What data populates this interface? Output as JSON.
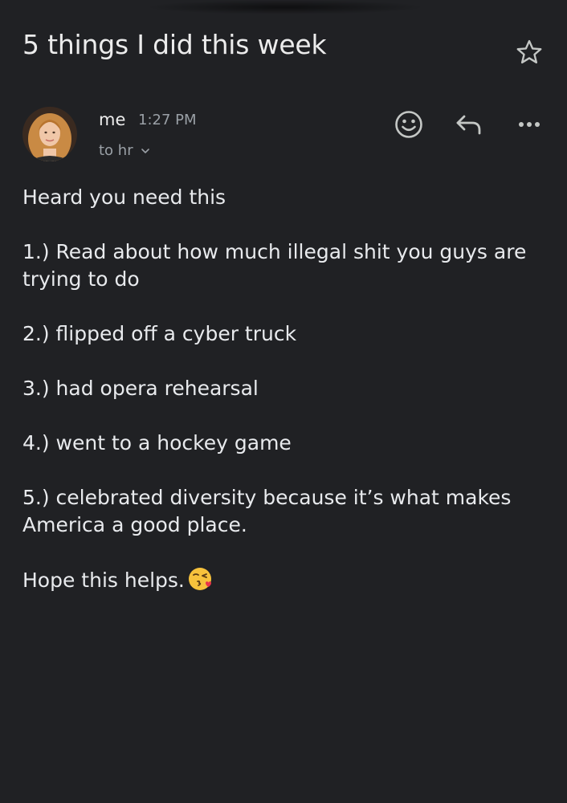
{
  "email": {
    "subject": "5 things I did this week",
    "sender": {
      "name": "me",
      "time": "1:27 PM",
      "recipient": "to hr"
    },
    "body": {
      "greeting": "Heard you need this",
      "items": [
        "1.) Read about how much illegal shit you guys are trying to do",
        "2.) flipped off a cyber truck",
        "3.) had opera rehearsal",
        "4.) went to a hockey game",
        "5.) celebrated diversity because it’s what makes America a good place."
      ],
      "closing": "Hope this helps."
    }
  },
  "icons": {
    "star": "star-outline-icon",
    "emoji_reaction": "smiley-face-icon",
    "reply": "reply-arrow-icon",
    "more": "more-dots-icon",
    "recipient_toggle": "chevron-down-icon",
    "closing_emoji": "face-blowing-kiss-emoji"
  },
  "colors": {
    "background": "#202124",
    "primary_text": "#e8eaed",
    "secondary_text": "#9aa0a6",
    "icon": "#c4c7c5"
  }
}
